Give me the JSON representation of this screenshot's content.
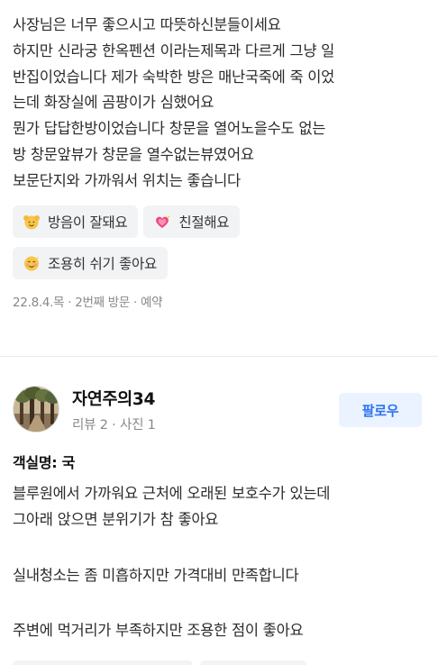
{
  "review1": {
    "lines": [
      "사장님은 너무 좋으시고 따뜻하신분들이세요",
      "하지만 신라궁 한옥펜션 이라는제목과 다르게 그냥 일",
      "반집이었습니다 제가 숙박한 방은 매난국죽에 죽 이었",
      "는데 화장실에 곰팡이가 심했어요",
      "뭔가 답답한방이었습니다 창문을 열어노을수도 없는",
      "방 창문앞뷰가 창문을 열수없는뷰였어요",
      "보문단지와 가까워서 위치는 좋습니다"
    ],
    "tags": [
      {
        "icon": "hands-up-emoji-icon",
        "label": "방음이 잘돼요"
      },
      {
        "icon": "sparkling-heart-emoji-icon",
        "label": "친절해요"
      },
      {
        "icon": "smiling-face-emoji-icon",
        "label": "조용히 쉬기 좋아요"
      }
    ],
    "meta": "22.8.4.목 · 2번째 방문 · 예약"
  },
  "review2": {
    "author": "자연주의34",
    "stats": "리뷰 2 · 사진 1",
    "follow_label": "팔로우",
    "room": "객실명: 국",
    "paragraphs": [
      [
        "블루원에서 가까워요 근처에 오래된 보호수가 있는데",
        "그아래 앉으면 분위기가 참 좋아요"
      ],
      [
        "실내청소는 좀 미흡하지만 가격대비 만족합니다"
      ],
      [
        "주변에 먹거리가 부족하지만 조용한 점이 좋아요"
      ]
    ]
  },
  "colors": {
    "accent": "#2f73f0",
    "follow_bg": "#eaf3ff",
    "tag_bg": "#f2f3f5",
    "meta_text": "#888888"
  }
}
